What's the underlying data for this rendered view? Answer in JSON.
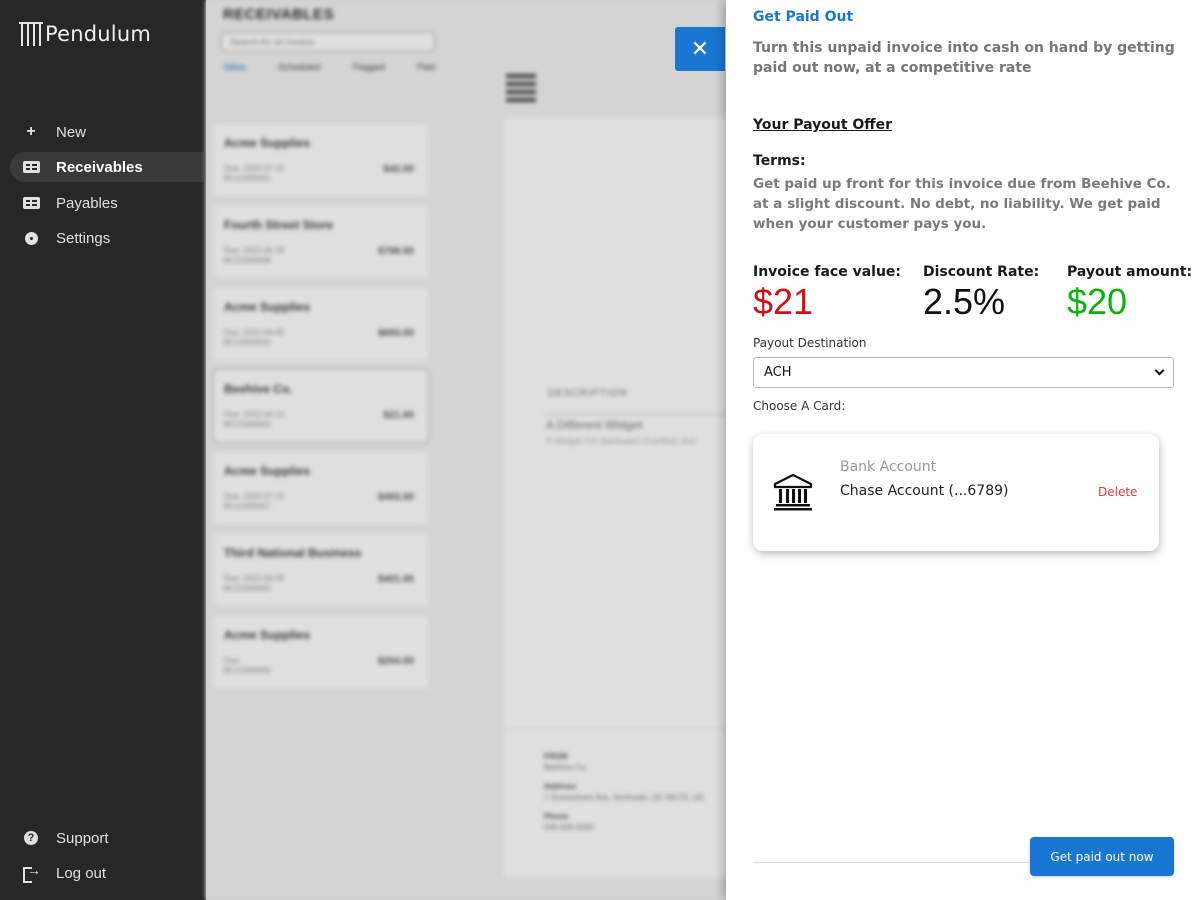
{
  "app": {
    "name": "Pendulum"
  },
  "sidebar": {
    "items": [
      {
        "label": "New",
        "icon": "plus-icon"
      },
      {
        "label": "Receivables",
        "icon": "credit-card-icon",
        "active": true
      },
      {
        "label": "Payables",
        "icon": "credit-card-icon"
      },
      {
        "label": "Settings",
        "icon": "gear-icon"
      }
    ],
    "footer": [
      {
        "label": "Support",
        "icon": "question-circle-icon"
      },
      {
        "label": "Log out",
        "icon": "logout-icon"
      }
    ]
  },
  "background": {
    "title": "RECEIVABLES",
    "search_placeholder": "Search for an invoice",
    "tabs": [
      "Inbox",
      "Scheduled",
      "Flagged",
      "Paid"
    ],
    "invoices": [
      {
        "name": "Acme Supplies",
        "due": "Due: 2022-07-15",
        "id": "BC21000001",
        "amount": "$42.00"
      },
      {
        "name": "Fourth Street Store",
        "due": "Due: 2022-06-18",
        "id": "BC21000008",
        "amount": "$798.50"
      },
      {
        "name": "Acme Supplies",
        "due": "Due: 2022-04-05",
        "id": "BC21000003",
        "amount": "$693.00"
      },
      {
        "name": "Beehive Co.",
        "due": "Due: 2022-04-14",
        "id": "BC21000002",
        "amount": "$21.00",
        "selected": true
      },
      {
        "name": "Acme Supplies",
        "due": "Due: 2022-07-15",
        "id": "BC21000007",
        "amount": "$493.00"
      },
      {
        "name": "Third National Business",
        "due": "Due: 2022-04-05",
        "id": "BC21000005",
        "amount": "$401.00"
      },
      {
        "name": "Acme Supplies",
        "due": "Due:",
        "id": "BC21000006",
        "amount": "$204.00"
      }
    ],
    "invoice_detail": {
      "column_header": "DESCRIPTION",
      "item": "A Different Widget",
      "item_sub": "A Widget For Backward Overflow and",
      "from_label": "FROM",
      "from_value": "Beehive Co.",
      "address_label": "Address",
      "address_value": "1 Somewhere Ave, Northside, DC 86170, US",
      "phone_label": "Phone",
      "phone_value": "000-000-0000"
    }
  },
  "drawer": {
    "close_symbol": "✕",
    "title": "Get Paid Out",
    "subtitle": "Turn this unpaid invoice into cash on hand by getting paid out now, at a competitive rate",
    "offer_heading": "Your Payout Offer",
    "terms_heading": "Terms:",
    "terms_text": "Get paid up front for this invoice due from Beehive Co. at a slight discount. No debt, no liability. We get paid when your customer pays you.",
    "stats": {
      "face_value_label": "Invoice face value:",
      "face_value": "$21",
      "discount_label": "Discount Rate:",
      "discount": "2.5%",
      "payout_label": "Payout amount:",
      "payout": "$20"
    },
    "destination_label": "Payout Destination",
    "destination_value": "ACH",
    "card_label": "Choose A Card:",
    "card": {
      "type": "Bank Account",
      "name": "Chase Account (...6789)",
      "delete_label": "Delete",
      "icon": "bank-icon"
    },
    "submit_label": "Get paid out now"
  },
  "colors": {
    "accent": "#1976d2",
    "sidebar_bg": "#272727",
    "negative": "#d0101a",
    "positive": "#10b010",
    "danger": "#e53935"
  }
}
